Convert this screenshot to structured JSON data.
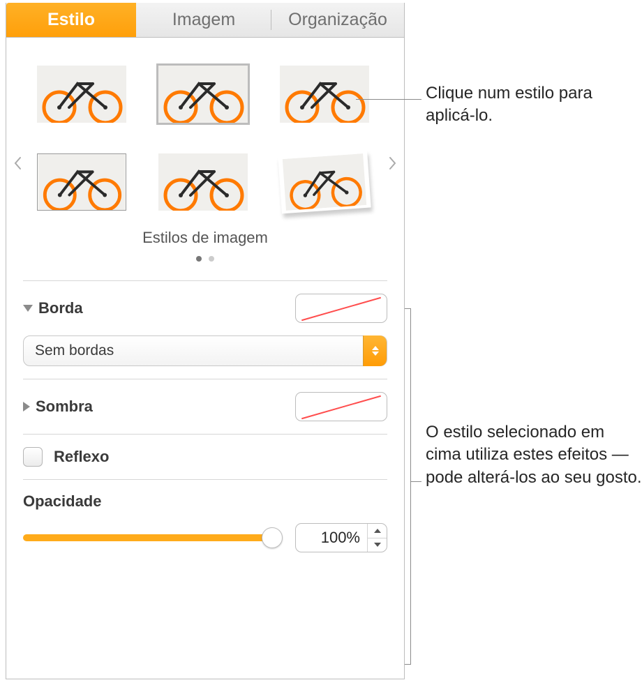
{
  "tabs": {
    "style": "Estilo",
    "image": "Imagem",
    "arrange": "Organização"
  },
  "gallery": {
    "title": "Estilos de imagem"
  },
  "border": {
    "label": "Borda",
    "select": "Sem bordas"
  },
  "shadow": {
    "label": "Sombra"
  },
  "reflection": {
    "label": "Reflexo"
  },
  "opacity": {
    "label": "Opacidade",
    "value": "100%"
  },
  "callouts": {
    "styles": "Clique num estilo para aplicá-lo.",
    "effects": "O estilo selecionado em cima utiliza estes efeitos — pode alterá-los ao seu gosto."
  }
}
